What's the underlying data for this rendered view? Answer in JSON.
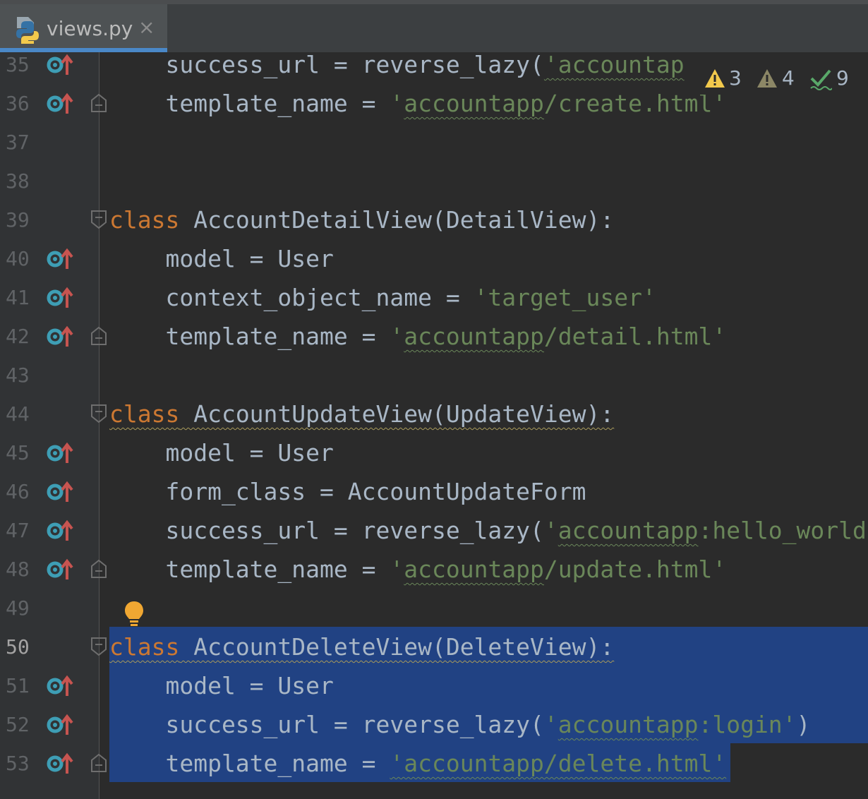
{
  "tab": {
    "filename": "views.py",
    "close": "×"
  },
  "inspection": {
    "errors": "3",
    "warnings": "4",
    "ok": "9"
  },
  "lines": [
    {
      "n": "35",
      "text": "    success_url = reverse_lazy('accountap"
    },
    {
      "n": "36",
      "text": "    template_name = 'accountapp/create.html'"
    },
    {
      "n": "37",
      "text": ""
    },
    {
      "n": "38",
      "text": ""
    },
    {
      "n": "39",
      "text": "class AccountDetailView(DetailView):"
    },
    {
      "n": "40",
      "text": "    model = User"
    },
    {
      "n": "41",
      "text": "    context_object_name = 'target_user'"
    },
    {
      "n": "42",
      "text": "    template_name = 'accountapp/detail.html'"
    },
    {
      "n": "43",
      "text": ""
    },
    {
      "n": "44",
      "text": "class AccountUpdateView(UpdateView):"
    },
    {
      "n": "45",
      "text": "    model = User"
    },
    {
      "n": "46",
      "text": "    form_class = AccountUpdateForm"
    },
    {
      "n": "47",
      "text": "    success_url = reverse_lazy('accountapp:hello_world"
    },
    {
      "n": "48",
      "text": "    template_name = 'accountapp/update.html'"
    },
    {
      "n": "49",
      "text": ""
    },
    {
      "n": "50",
      "text": "class AccountDeleteView(DeleteView):"
    },
    {
      "n": "51",
      "text": "    model = User"
    },
    {
      "n": "52",
      "text": "    success_url = reverse_lazy('accountapp:login')"
    },
    {
      "n": "53",
      "text": "    template_name = 'accountapp/delete.html'"
    }
  ],
  "colors": {
    "background": "#2b2b2b",
    "gutter": "#313335",
    "selection": "#214283",
    "keyword": "#cc7832",
    "string": "#6a8759",
    "text": "#a9b7c6",
    "line_number": "#606366",
    "tab_accent": "#4a88c7"
  }
}
